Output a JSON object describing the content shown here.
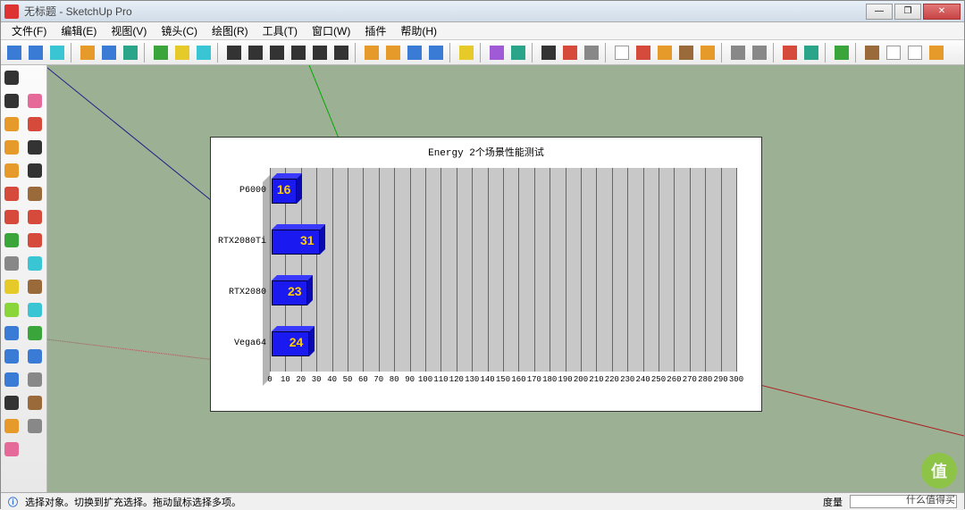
{
  "title": "无标题 - SketchUp Pro",
  "menu": [
    "文件(F)",
    "编辑(E)",
    "视图(V)",
    "镜头(C)",
    "绘图(R)",
    "工具(T)",
    "窗口(W)",
    "插件",
    "帮助(H)"
  ],
  "winbtns": {
    "min": "—",
    "max": "❐",
    "close": "✕"
  },
  "status": {
    "info_icon": "ⓘ",
    "hint": "选择对象。切换到扩充选择。拖动鼠标选择多项。",
    "measure_label": "度量"
  },
  "watermark": {
    "badge": "值",
    "text": "什么值得买"
  },
  "topTools": [
    {
      "name": "model",
      "c": "c-blue"
    },
    {
      "name": "open",
      "c": "c-blue"
    },
    {
      "name": "save",
      "c": "c-cyan"
    },
    {
      "name": "sep"
    },
    {
      "name": "cube1",
      "c": "c-orange"
    },
    {
      "name": "cube2",
      "c": "c-blue"
    },
    {
      "name": "cube3",
      "c": "c-teal"
    },
    {
      "name": "sep"
    },
    {
      "name": "box",
      "c": "c-green"
    },
    {
      "name": "palette",
      "c": "c-yellow"
    },
    {
      "name": "info",
      "c": "c-cyan"
    },
    {
      "name": "sep"
    },
    {
      "name": "camera",
      "c": "c-black"
    },
    {
      "name": "rewind",
      "c": "c-black"
    },
    {
      "name": "prev",
      "c": "c-black"
    },
    {
      "name": "play",
      "c": "c-black"
    },
    {
      "name": "next",
      "c": "c-black"
    },
    {
      "name": "end",
      "c": "c-black"
    },
    {
      "name": "sep"
    },
    {
      "name": "package1",
      "c": "c-orange"
    },
    {
      "name": "package2",
      "c": "c-orange"
    },
    {
      "name": "reload1",
      "c": "c-blue"
    },
    {
      "name": "reload2",
      "c": "c-blue"
    },
    {
      "name": "sep"
    },
    {
      "name": "warn",
      "c": "c-yellow"
    },
    {
      "name": "sep"
    },
    {
      "name": "cube4",
      "c": "c-purple"
    },
    {
      "name": "cube5",
      "c": "c-teal"
    },
    {
      "name": "sep"
    },
    {
      "name": "plug",
      "c": "c-black"
    },
    {
      "name": "globe",
      "c": "c-red"
    },
    {
      "name": "grid",
      "c": "c-gray"
    },
    {
      "name": "sep"
    },
    {
      "name": "cursor",
      "c": "c-white"
    },
    {
      "name": "spin",
      "c": "c-red"
    },
    {
      "name": "sun",
      "c": "c-orange"
    },
    {
      "name": "layers",
      "c": "c-brown"
    },
    {
      "name": "paint",
      "c": "c-orange"
    },
    {
      "name": "sep"
    },
    {
      "name": "wrench",
      "c": "c-gray"
    },
    {
      "name": "gear",
      "c": "c-gray"
    },
    {
      "name": "sep"
    },
    {
      "name": "refresh",
      "c": "c-red"
    },
    {
      "name": "globe2",
      "c": "c-teal"
    },
    {
      "name": "sep"
    },
    {
      "name": "help",
      "c": "c-green"
    },
    {
      "name": "sep"
    },
    {
      "name": "house1",
      "c": "c-brown"
    },
    {
      "name": "house2",
      "c": "c-white"
    },
    {
      "name": "house3",
      "c": "c-white"
    },
    {
      "name": "house4",
      "c": "c-orange"
    }
  ],
  "sideTools": [
    {
      "name": "select",
      "c": "c-black"
    },
    {
      "name": "blank",
      "c": ""
    },
    {
      "name": "line",
      "c": "c-black"
    },
    {
      "name": "eraser",
      "c": "c-pink"
    },
    {
      "name": "rect",
      "c": "c-orange"
    },
    {
      "name": "pencil",
      "c": "c-red"
    },
    {
      "name": "circle",
      "c": "c-orange"
    },
    {
      "name": "arc",
      "c": "c-black"
    },
    {
      "name": "polygon",
      "c": "c-orange"
    },
    {
      "name": "freehand",
      "c": "c-black"
    },
    {
      "name": "pushpull",
      "c": "c-red"
    },
    {
      "name": "move",
      "c": "c-brown"
    },
    {
      "name": "rotate",
      "c": "c-red"
    },
    {
      "name": "followme",
      "c": "c-red"
    },
    {
      "name": "scale",
      "c": "c-green"
    },
    {
      "name": "offset",
      "c": "c-red"
    },
    {
      "name": "tape",
      "c": "c-gray"
    },
    {
      "name": "dim",
      "c": "c-cyan"
    },
    {
      "name": "protractor",
      "c": "c-yellow"
    },
    {
      "name": "text",
      "c": "c-brown"
    },
    {
      "name": "axes",
      "c": "c-lime"
    },
    {
      "name": "3dtext",
      "c": "c-cyan"
    },
    {
      "name": "orbit",
      "c": "c-blue"
    },
    {
      "name": "pan",
      "c": "c-green"
    },
    {
      "name": "zoom",
      "c": "c-blue"
    },
    {
      "name": "zoomwin",
      "c": "c-blue"
    },
    {
      "name": "prev-view",
      "c": "c-blue"
    },
    {
      "name": "look",
      "c": "c-gray"
    },
    {
      "name": "walk",
      "c": "c-black"
    },
    {
      "name": "position",
      "c": "c-brown"
    },
    {
      "name": "section",
      "c": "c-orange"
    },
    {
      "name": "dot",
      "c": "c-gray"
    },
    {
      "name": "component",
      "c": "c-pink"
    },
    {
      "name": "blank2",
      "c": ""
    }
  ],
  "chart_data": {
    "type": "bar",
    "orientation": "horizontal",
    "title": "Energy 2个场景性能测试",
    "categories": [
      "P6000",
      "RTX2080Ti",
      "RTX2080",
      "Vega64"
    ],
    "values": [
      16,
      31,
      23,
      24
    ],
    "xlim": [
      0,
      300
    ],
    "xticks": [
      0,
      10,
      20,
      30,
      40,
      50,
      60,
      70,
      80,
      90,
      100,
      110,
      120,
      130,
      140,
      150,
      160,
      170,
      180,
      190,
      200,
      210,
      220,
      230,
      240,
      250,
      260,
      270,
      280,
      290,
      300
    ],
    "bar_color": "#1a1af0",
    "value_color": "#ffcc00"
  }
}
